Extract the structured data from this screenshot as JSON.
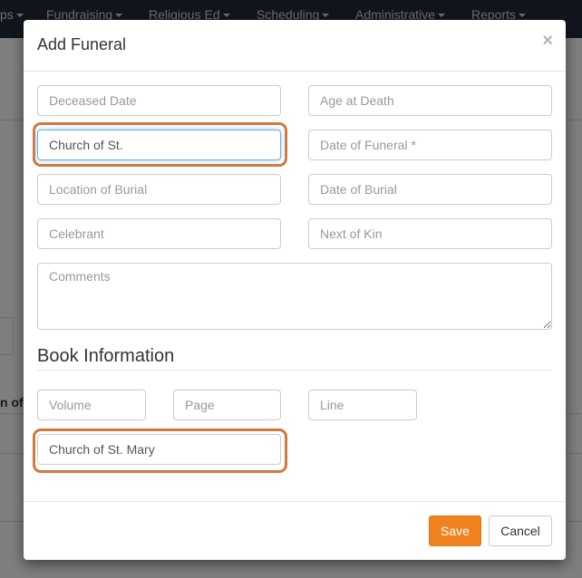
{
  "nav": {
    "items": [
      {
        "label": "ps"
      },
      {
        "label": "Fundraising"
      },
      {
        "label": "Religious Ed"
      },
      {
        "label": "Scheduling"
      },
      {
        "label": "Administrative"
      },
      {
        "label": "Reports"
      }
    ]
  },
  "background": {
    "partial_text": "n of"
  },
  "modal": {
    "title": "Add Funeral",
    "close_label": "×",
    "fields": {
      "deceased_date": {
        "placeholder": "Deceased Date",
        "value": ""
      },
      "age_at_death": {
        "placeholder": "Age at Death",
        "value": ""
      },
      "church": {
        "placeholder": "",
        "value": "Church of St."
      },
      "date_of_funeral": {
        "placeholder": "Date of Funeral *",
        "value": ""
      },
      "location_of_burial": {
        "placeholder": "Location of Burial",
        "value": ""
      },
      "date_of_burial": {
        "placeholder": "Date of Burial",
        "value": ""
      },
      "celebrant": {
        "placeholder": "Celebrant",
        "value": ""
      },
      "next_of_kin": {
        "placeholder": "Next of Kin",
        "value": ""
      },
      "comments": {
        "placeholder": "Comments",
        "value": ""
      }
    },
    "book_section": {
      "title": "Book Information",
      "volume": {
        "placeholder": "Volume",
        "value": ""
      },
      "page": {
        "placeholder": "Page",
        "value": ""
      },
      "line": {
        "placeholder": "Line",
        "value": ""
      },
      "church_book": {
        "placeholder": "",
        "value": "Church of St. Mary"
      }
    },
    "footer": {
      "save_label": "Save",
      "cancel_label": "Cancel"
    }
  },
  "colors": {
    "nav_bg": "#222b3c",
    "save_button": "#f0821f",
    "highlight": "#d2793e",
    "focus_border": "#66afe9"
  }
}
